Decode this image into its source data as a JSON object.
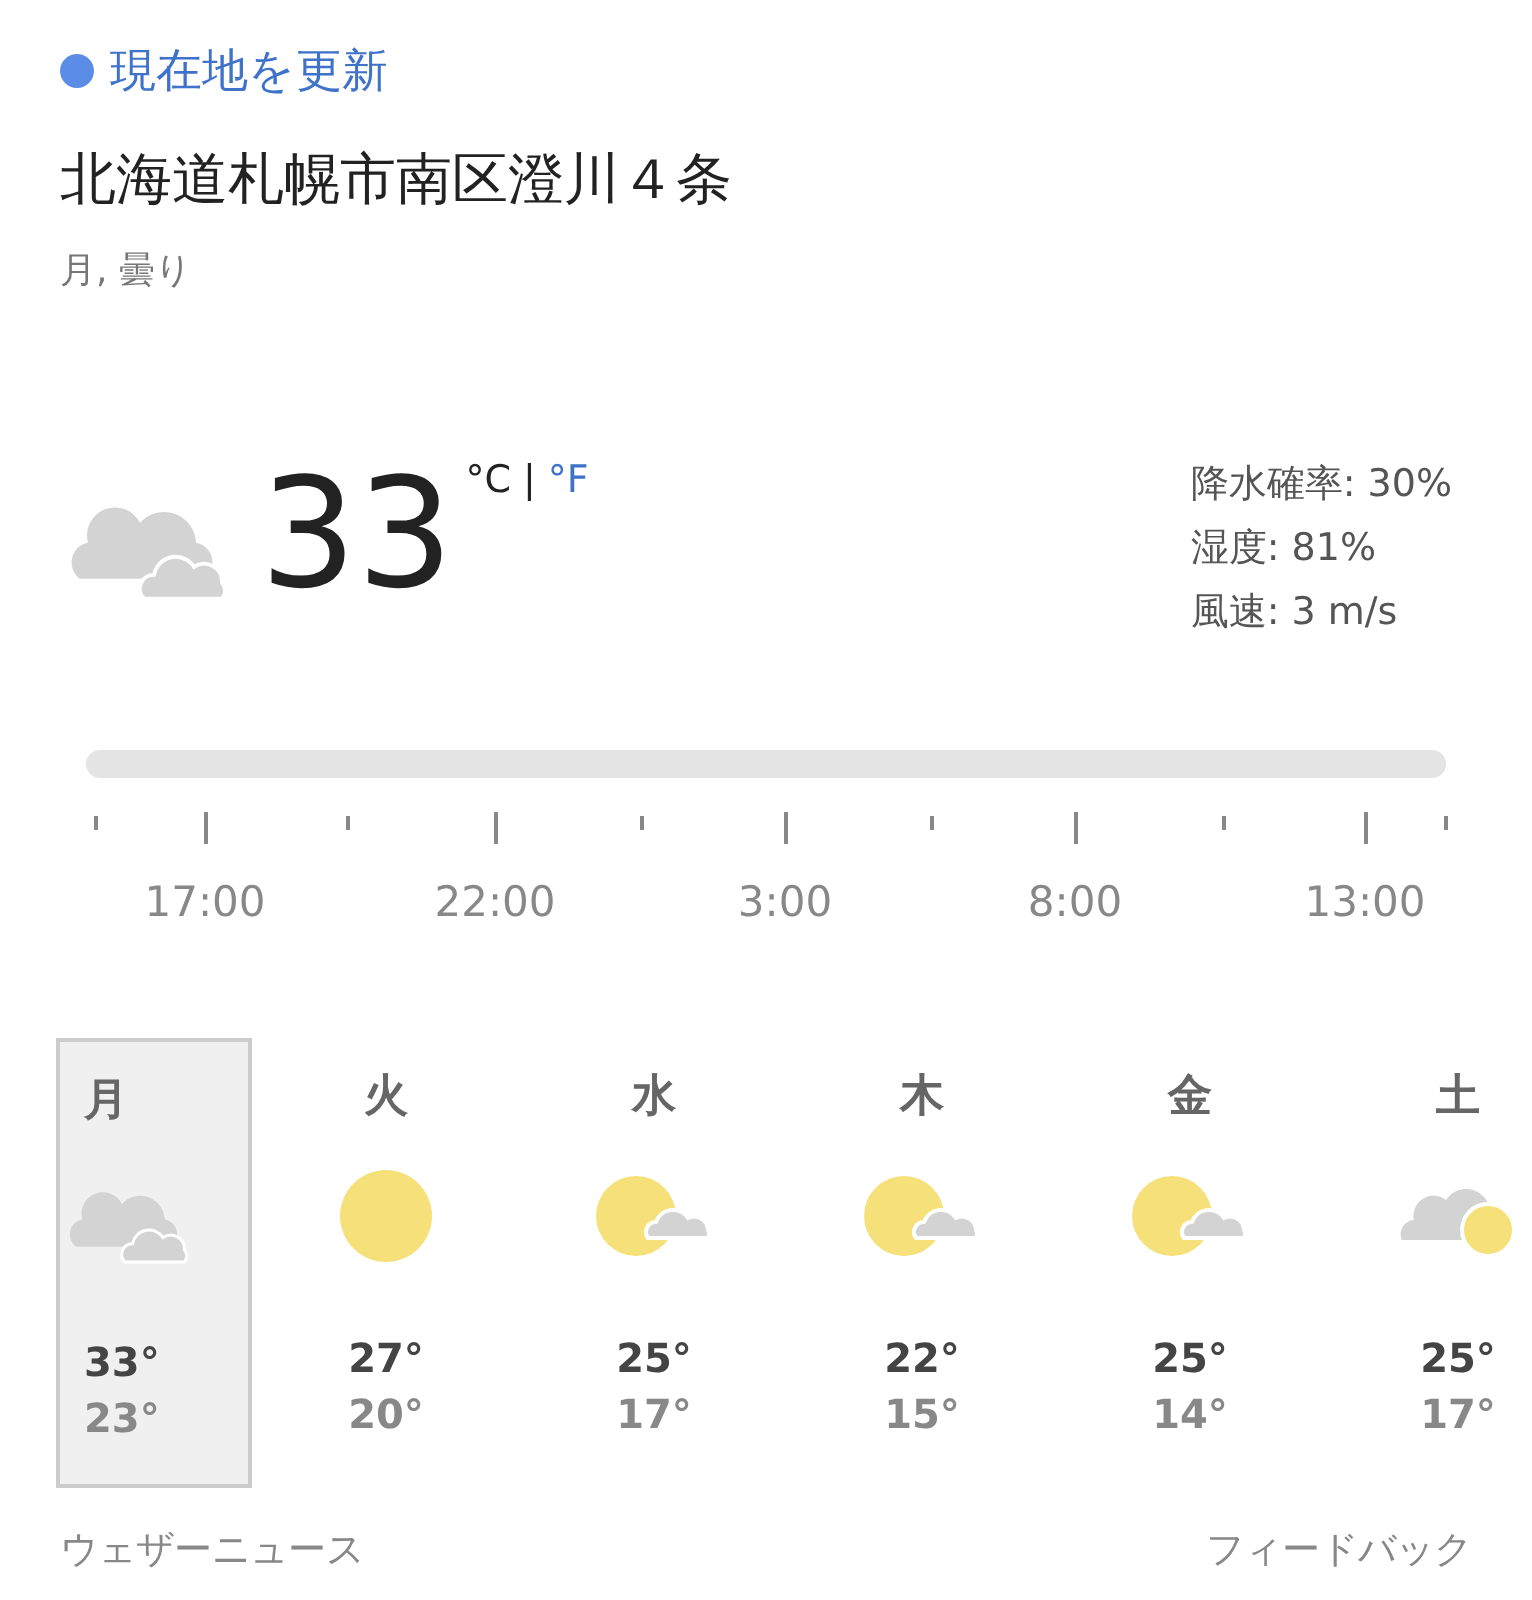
{
  "refresh_location": {
    "label": "現在地を更新"
  },
  "location": "北海道札幌市南区澄川４条",
  "condition": "月, 曇り",
  "current": {
    "kind": "cloudy",
    "temperature": "33",
    "units": [
      {
        "label": "°C",
        "selected": true
      },
      {
        "label": "°F",
        "selected": false
      }
    ],
    "unit_separator": "|",
    "details": [
      "降水確率: 30%",
      "湿度: 81%",
      "風速: 3 m/s"
    ]
  },
  "timeline": {
    "labels": [
      "17:00",
      "22:00",
      "3:00",
      "8:00",
      "13:00"
    ]
  },
  "days": [
    {
      "day": "月",
      "kind": "cloudy",
      "high": "33°",
      "low": "23°",
      "selected": true
    },
    {
      "day": "火",
      "kind": "sunny",
      "high": "27°",
      "low": "20°",
      "selected": false
    },
    {
      "day": "水",
      "kind": "sun-cloud",
      "high": "25°",
      "low": "17°",
      "selected": false
    },
    {
      "day": "木",
      "kind": "sun-cloud",
      "high": "22°",
      "low": "15°",
      "selected": false
    },
    {
      "day": "金",
      "kind": "sun-cloud",
      "high": "25°",
      "low": "14°",
      "selected": false
    },
    {
      "day": "土",
      "kind": "cloud-sun",
      "high": "25°",
      "low": "17°",
      "selected": false
    }
  ],
  "footer": {
    "left": "ウェザーニュース",
    "right": "フィードバック"
  }
}
